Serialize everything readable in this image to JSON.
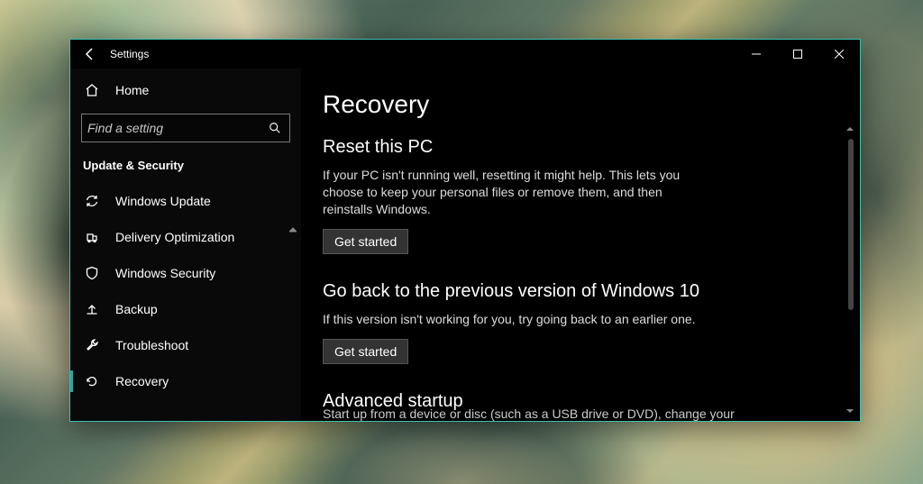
{
  "window": {
    "title": "Settings"
  },
  "sidebar": {
    "home": "Home",
    "search_placeholder": "Find a setting",
    "group": "Update & Security",
    "items": [
      {
        "label": "Windows Update"
      },
      {
        "label": "Delivery Optimization"
      },
      {
        "label": "Windows Security"
      },
      {
        "label": "Backup"
      },
      {
        "label": "Troubleshoot"
      },
      {
        "label": "Recovery"
      }
    ]
  },
  "main": {
    "title": "Recovery",
    "sections": [
      {
        "heading": "Reset this PC",
        "body": "If your PC isn't running well, resetting it might help. This lets you choose to keep your personal files or remove them, and then reinstalls Windows.",
        "button": "Get started"
      },
      {
        "heading": "Go back to the previous version of Windows 10",
        "body": "If this version isn't working for you, try going back to an earlier one.",
        "button": "Get started"
      },
      {
        "heading": "Advanced startup",
        "body_cutoff": "Start up from a device or disc (such as a USB drive or DVD), change your"
      }
    ]
  }
}
